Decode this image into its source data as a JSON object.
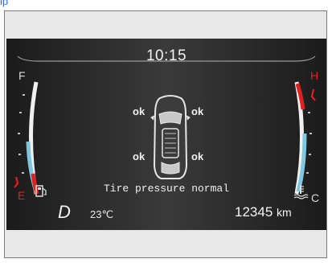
{
  "header": {
    "corner_label": "ip"
  },
  "display": {
    "time": "10:15",
    "fuel_gauge": {
      "full_label": "F",
      "empty_label": "E",
      "icon": "fuel-pump-icon"
    },
    "temp_gauge": {
      "hot_label": "H",
      "cold_label": "C",
      "icon": "coolant-temperature-icon"
    },
    "tires": {
      "front_left": "ok",
      "front_right": "ok",
      "rear_left": "ok",
      "rear_right": "ok",
      "car_icon": "car-top-view-icon"
    },
    "status_message": "Tire pressure normal",
    "gear": "D",
    "outside_temp": "23℃",
    "odometer": {
      "value": "12345",
      "unit": "km"
    }
  },
  "colors": {
    "display_bg": "#2c2c2c",
    "frame_bg": "#e8e8e8",
    "warning_red": "#e02020",
    "gauge_blue": "#7fc7e0",
    "gauge_white": "#f0f0f0",
    "label_blue": "#2a6fd6"
  }
}
